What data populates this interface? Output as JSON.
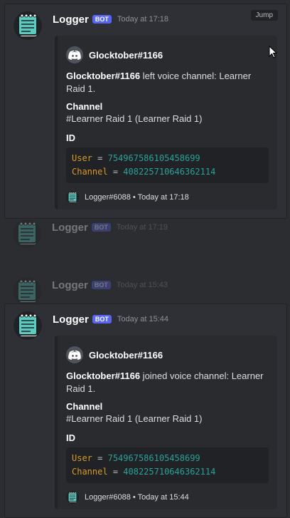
{
  "messages": [
    {
      "author": "Logger",
      "badge": "BOT",
      "timestamp": "Today at 17:18",
      "jump_label": "Jump",
      "embed": {
        "author": "Glocktober#1166",
        "desc_user": "Glocktober#1166",
        "desc_text": " left voice channel: Learner Raid 1.",
        "field1_name": "Channel",
        "field1_value": "#Learner Raid 1 (Learner Raid 1)",
        "field2_name": "ID",
        "code": {
          "user_key": "User",
          "user_val": "754967586105458699",
          "channel_key": "Channel",
          "channel_val": "408225710646362114",
          "eq": "="
        },
        "footer": "Logger#6088 • Today at 17:18"
      }
    },
    {
      "author": "Logger",
      "badge": "BOT",
      "timestamp": "Today at 17:19"
    },
    {
      "author": "Logger",
      "badge": "BOT",
      "timestamp": "Today at 15:43"
    },
    {
      "author": "Logger",
      "badge": "BOT",
      "timestamp": "Today at 15:44",
      "embed": {
        "author": "Glocktober#1166",
        "desc_user": "Glocktober#1166",
        "desc_text": " joined voice channel: Learner Raid 1.",
        "field1_name": "Channel",
        "field1_value": "#Learner Raid 1 (Learner Raid 1)",
        "field2_name": "ID",
        "code": {
          "user_key": "User",
          "user_val": "754967586105458699",
          "channel_key": "Channel",
          "channel_val": "408225710646362114",
          "eq": "="
        },
        "footer": "Logger#6088 • Today at 15:44"
      }
    }
  ],
  "icons": {
    "avatar": "notepad-icon",
    "embed_author": "discord-icon",
    "cursor": "cursor-icon"
  },
  "colors": {
    "bot_badge": "#5865f2",
    "code_key": "#d99a2a",
    "code_value": "#2aa198",
    "background": "#2b2d31"
  }
}
